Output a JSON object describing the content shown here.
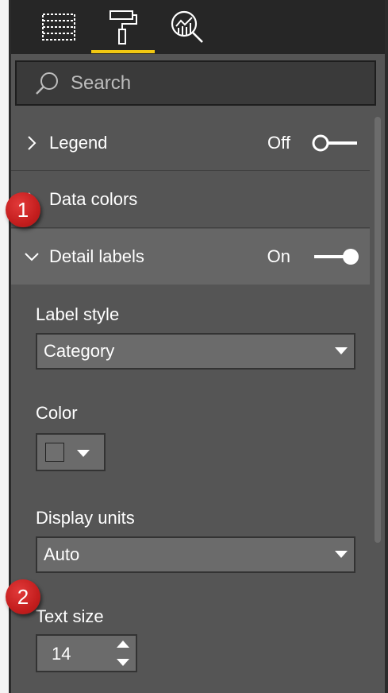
{
  "toolbar": {
    "tabs": [
      {
        "icon": "fields-icon"
      },
      {
        "icon": "format-paint-roller-icon",
        "active": true
      },
      {
        "icon": "analytics-magnifier-icon"
      }
    ],
    "accent_color": "#f2c811"
  },
  "search": {
    "placeholder": "Search"
  },
  "sections": {
    "legend": {
      "label": "Legend",
      "state": "Off",
      "on": false
    },
    "data_colors": {
      "label": "Data colors"
    },
    "detail_labels": {
      "label": "Detail labels",
      "state": "On",
      "on": true
    }
  },
  "detail_settings": {
    "label_style": {
      "label": "Label style",
      "value": "Category"
    },
    "color": {
      "label": "Color",
      "value": "#6f6f6f"
    },
    "display_units": {
      "label": "Display units",
      "value": "Auto"
    },
    "text_size": {
      "label": "Text size",
      "value": "14"
    }
  },
  "callouts": [
    "1",
    "2"
  ]
}
